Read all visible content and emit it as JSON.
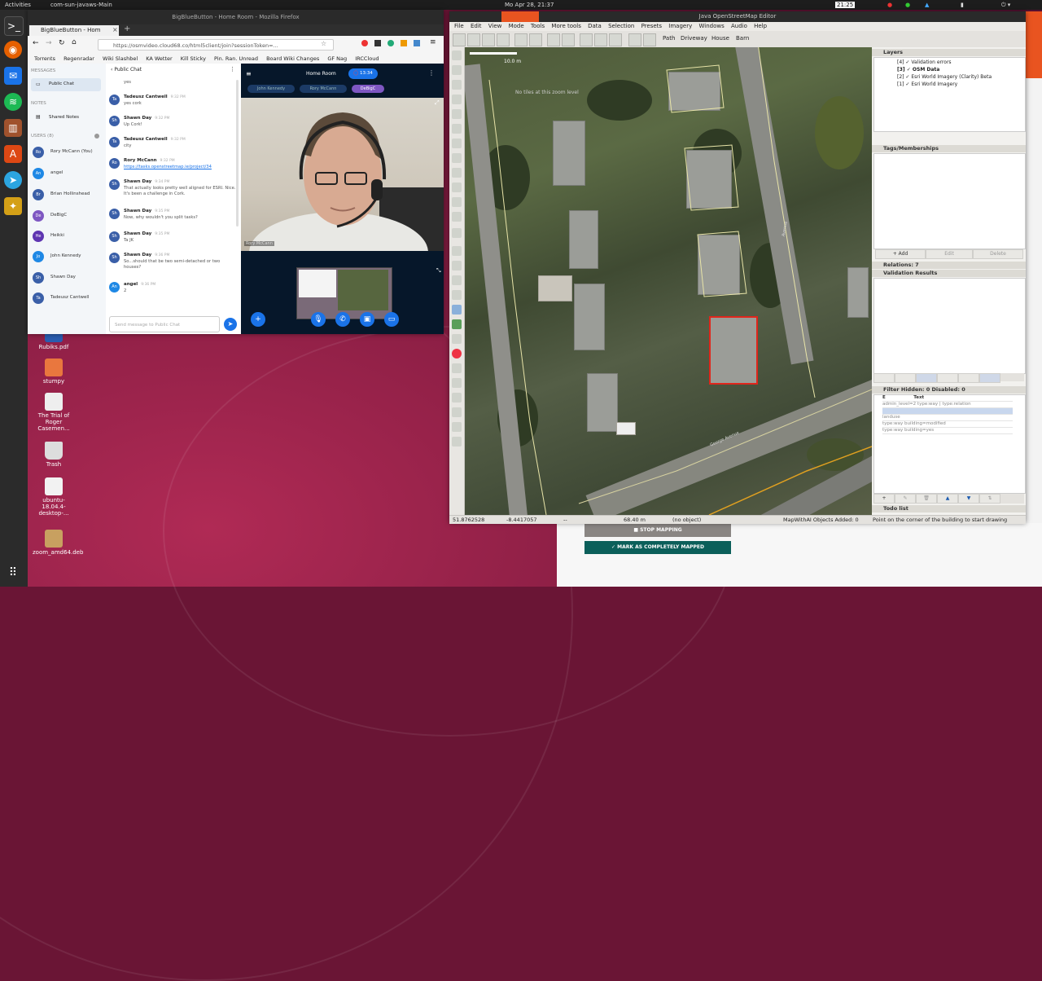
{
  "topbar": {
    "activities": "Activities",
    "app_menu": "com-sun-javaws-Main",
    "clock": "Mo Apr 28, 21:37",
    "workspace": "21:25"
  },
  "desktop_icons": [
    {
      "label": "Rubiks.pdf"
    },
    {
      "label": "stumpy"
    },
    {
      "label": "The Trial of Roger Casemen..."
    },
    {
      "label": "Trash"
    },
    {
      "label": "ubuntu-18.04.4-desktop-..."
    },
    {
      "label": "zoom_amd64.deb"
    }
  ],
  "firefox": {
    "window_title": "BigBlueButton - Home Room - Mozilla Firefox",
    "tab_title": "BigBlueButton - Hom",
    "url": "https://osmvideo.cloud68.co/html5client/join?sessionToken=...",
    "bookmarks": [
      "Torrents",
      "Regenradar",
      "Wiki Slashbel",
      "KA Wetter",
      "Kill Sticky",
      "Pin. Ran. Unread",
      "Board Wiki Changes",
      "GF Nag",
      "IRCCloud"
    ]
  },
  "bbb": {
    "messages_header": "MESSAGES",
    "public_chat": "Public Chat",
    "notes_header": "NOTES",
    "shared_notes": "Shared Notes",
    "users_header": "USERS (8)",
    "users": [
      {
        "initials": "Ro",
        "name": "Rory McCann (You)",
        "color": "#3a5fa8"
      },
      {
        "initials": "An",
        "name": "angel",
        "color": "#1e88e5"
      },
      {
        "initials": "Br",
        "name": "Brian Hollinshead",
        "color": "#3a5fa8"
      },
      {
        "initials": "De",
        "name": "DeBigC",
        "color": "#7e57c2"
      },
      {
        "initials": "He",
        "name": "Heikki",
        "color": "#5e35b1"
      },
      {
        "initials": "Jo",
        "name": "John Kennedy",
        "color": "#1e88e5"
      },
      {
        "initials": "Sh",
        "name": "Shawn Day",
        "color": "#3a5fa8"
      },
      {
        "initials": "Ta",
        "name": "Tadeusz Cantwell",
        "color": "#3a5fa8"
      }
    ],
    "chat_title": "Public Chat",
    "messages": [
      {
        "initials": "",
        "name": "",
        "time": "",
        "text": "yes"
      },
      {
        "initials": "Ta",
        "name": "Tadeusz Cantwell",
        "time": "9:32 PM",
        "text": "yes cork"
      },
      {
        "initials": "Sh",
        "name": "Shawn Day",
        "time": "9:32 PM",
        "text": "Up Cork!"
      },
      {
        "initials": "Ta",
        "name": "Tadeusz Cantwell",
        "time": "9:32 PM",
        "text": "city"
      },
      {
        "initials": "Ro",
        "name": "Rory McCann",
        "time": "9:32 PM",
        "text": "https://tasks.openstreetmap.ie/project/34"
      },
      {
        "initials": "Sh",
        "name": "Shawn Day",
        "time": "9:34 PM",
        "text": "That actually looks pretty well aligned for ESRI. Nice. It's been a challenge in Cork."
      },
      {
        "initials": "Sh",
        "name": "Shawn Day",
        "time": "9:35 PM",
        "text": "Now, why wouldn't you split tasks?"
      },
      {
        "initials": "Sh",
        "name": "Shawn Day",
        "time": "9:35 PM",
        "text": "Ta JK"
      },
      {
        "initials": "Sh",
        "name": "Shawn Day",
        "time": "9:36 PM",
        "text": "So...should that be two semi-detached or two houses?"
      },
      {
        "initials": "An",
        "name": "angel",
        "time": "9:36 PM",
        "text": "2"
      }
    ],
    "input_placeholder": "Send message to Public Chat",
    "meeting_title": "Home Room",
    "recording_time": "13:34",
    "talkers": [
      "John Kennedy",
      "Rory McCann",
      "DeBigC"
    ],
    "cam_label": "Rory McCann"
  },
  "josm": {
    "title": "Java OpenStreetMap Editor",
    "menu": [
      "File",
      "Edit",
      "View",
      "Mode",
      "Tools",
      "More tools",
      "Data",
      "Selection",
      "Presets",
      "Imagery",
      "Windows",
      "Audio",
      "Help"
    ],
    "toolbar_presets": [
      "Path",
      "Driveway",
      "House",
      "Barn"
    ],
    "scale": "10.0 m",
    "map_notice": "No tiles at this zoom level",
    "street_label_1": "Avenue",
    "street_label_2": "George Avenue",
    "layers_title": "Layers",
    "layers": [
      {
        "idx": "[4]",
        "name": "Validation errors"
      },
      {
        "idx": "[3]",
        "name": "OSM Data"
      },
      {
        "idx": "[2]",
        "name": "Esri World Imagery (Clarity) Beta"
      },
      {
        "idx": "[1]",
        "name": "Esri World Imagery"
      }
    ],
    "tags_title": "Tags/Memberships",
    "btn_add": "Add",
    "btn_edit": "Edit",
    "btn_delete": "Delete",
    "relations_title": "Relations: 7",
    "validation_title": "Validation Results",
    "filter_title": "Filter Hidden: 0 Disabled: 0",
    "filter_cols": [
      "E",
      "Text",
      "H"
    ],
    "filters": [
      "admin_level=2 type:way | type:relation",
      "",
      "landuse",
      "type:way building=modified",
      "type:way building=yes"
    ],
    "todo_title": "Todo list",
    "status": {
      "lat": "51.8762528",
      "lon": "-8.4417057",
      "heading": "--",
      "dist": "68.40 m",
      "selection": "(no object)",
      "objects": "MapWithAI Objects Added: 0",
      "help": "Point on the corner of the building to start drawing"
    }
  },
  "tasking": {
    "stop_mapping": "STOP MAPPING",
    "mark_completed": "MARK AS COMPLETELY MAPPED"
  },
  "colors": {
    "bbb_blue": "#1a73e8",
    "bbb_dark": "#06172a",
    "tm_green": "#0b5f5a",
    "selected_building": "#e0261c"
  }
}
